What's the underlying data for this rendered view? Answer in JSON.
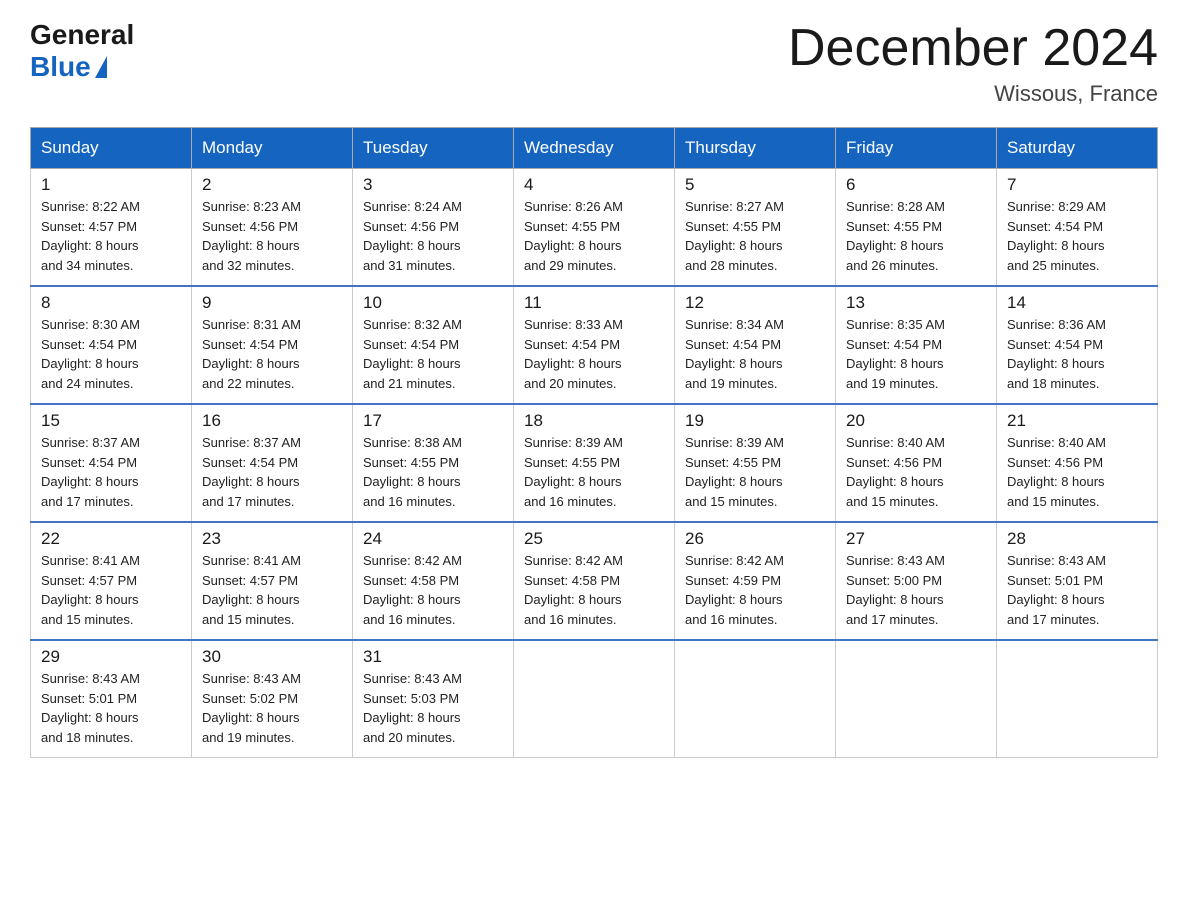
{
  "header": {
    "logo_general": "General",
    "logo_blue": "Blue",
    "month_title": "December 2024",
    "location": "Wissous, France"
  },
  "days_of_week": [
    "Sunday",
    "Monday",
    "Tuesday",
    "Wednesday",
    "Thursday",
    "Friday",
    "Saturday"
  ],
  "weeks": [
    [
      {
        "day": "1",
        "sunrise": "8:22 AM",
        "sunset": "4:57 PM",
        "daylight": "8 hours and 34 minutes."
      },
      {
        "day": "2",
        "sunrise": "8:23 AM",
        "sunset": "4:56 PM",
        "daylight": "8 hours and 32 minutes."
      },
      {
        "day": "3",
        "sunrise": "8:24 AM",
        "sunset": "4:56 PM",
        "daylight": "8 hours and 31 minutes."
      },
      {
        "day": "4",
        "sunrise": "8:26 AM",
        "sunset": "4:55 PM",
        "daylight": "8 hours and 29 minutes."
      },
      {
        "day": "5",
        "sunrise": "8:27 AM",
        "sunset": "4:55 PM",
        "daylight": "8 hours and 28 minutes."
      },
      {
        "day": "6",
        "sunrise": "8:28 AM",
        "sunset": "4:55 PM",
        "daylight": "8 hours and 26 minutes."
      },
      {
        "day": "7",
        "sunrise": "8:29 AM",
        "sunset": "4:54 PM",
        "daylight": "8 hours and 25 minutes."
      }
    ],
    [
      {
        "day": "8",
        "sunrise": "8:30 AM",
        "sunset": "4:54 PM",
        "daylight": "8 hours and 24 minutes."
      },
      {
        "day": "9",
        "sunrise": "8:31 AM",
        "sunset": "4:54 PM",
        "daylight": "8 hours and 22 minutes."
      },
      {
        "day": "10",
        "sunrise": "8:32 AM",
        "sunset": "4:54 PM",
        "daylight": "8 hours and 21 minutes."
      },
      {
        "day": "11",
        "sunrise": "8:33 AM",
        "sunset": "4:54 PM",
        "daylight": "8 hours and 20 minutes."
      },
      {
        "day": "12",
        "sunrise": "8:34 AM",
        "sunset": "4:54 PM",
        "daylight": "8 hours and 19 minutes."
      },
      {
        "day": "13",
        "sunrise": "8:35 AM",
        "sunset": "4:54 PM",
        "daylight": "8 hours and 19 minutes."
      },
      {
        "day": "14",
        "sunrise": "8:36 AM",
        "sunset": "4:54 PM",
        "daylight": "8 hours and 18 minutes."
      }
    ],
    [
      {
        "day": "15",
        "sunrise": "8:37 AM",
        "sunset": "4:54 PM",
        "daylight": "8 hours and 17 minutes."
      },
      {
        "day": "16",
        "sunrise": "8:37 AM",
        "sunset": "4:54 PM",
        "daylight": "8 hours and 17 minutes."
      },
      {
        "day": "17",
        "sunrise": "8:38 AM",
        "sunset": "4:55 PM",
        "daylight": "8 hours and 16 minutes."
      },
      {
        "day": "18",
        "sunrise": "8:39 AM",
        "sunset": "4:55 PM",
        "daylight": "8 hours and 16 minutes."
      },
      {
        "day": "19",
        "sunrise": "8:39 AM",
        "sunset": "4:55 PM",
        "daylight": "8 hours and 15 minutes."
      },
      {
        "day": "20",
        "sunrise": "8:40 AM",
        "sunset": "4:56 PM",
        "daylight": "8 hours and 15 minutes."
      },
      {
        "day": "21",
        "sunrise": "8:40 AM",
        "sunset": "4:56 PM",
        "daylight": "8 hours and 15 minutes."
      }
    ],
    [
      {
        "day": "22",
        "sunrise": "8:41 AM",
        "sunset": "4:57 PM",
        "daylight": "8 hours and 15 minutes."
      },
      {
        "day": "23",
        "sunrise": "8:41 AM",
        "sunset": "4:57 PM",
        "daylight": "8 hours and 15 minutes."
      },
      {
        "day": "24",
        "sunrise": "8:42 AM",
        "sunset": "4:58 PM",
        "daylight": "8 hours and 16 minutes."
      },
      {
        "day": "25",
        "sunrise": "8:42 AM",
        "sunset": "4:58 PM",
        "daylight": "8 hours and 16 minutes."
      },
      {
        "day": "26",
        "sunrise": "8:42 AM",
        "sunset": "4:59 PM",
        "daylight": "8 hours and 16 minutes."
      },
      {
        "day": "27",
        "sunrise": "8:43 AM",
        "sunset": "5:00 PM",
        "daylight": "8 hours and 17 minutes."
      },
      {
        "day": "28",
        "sunrise": "8:43 AM",
        "sunset": "5:01 PM",
        "daylight": "8 hours and 17 minutes."
      }
    ],
    [
      {
        "day": "29",
        "sunrise": "8:43 AM",
        "sunset": "5:01 PM",
        "daylight": "8 hours and 18 minutes."
      },
      {
        "day": "30",
        "sunrise": "8:43 AM",
        "sunset": "5:02 PM",
        "daylight": "8 hours and 19 minutes."
      },
      {
        "day": "31",
        "sunrise": "8:43 AM",
        "sunset": "5:03 PM",
        "daylight": "8 hours and 20 minutes."
      },
      null,
      null,
      null,
      null
    ]
  ],
  "labels": {
    "sunrise": "Sunrise:",
    "sunset": "Sunset:",
    "daylight": "Daylight:"
  }
}
